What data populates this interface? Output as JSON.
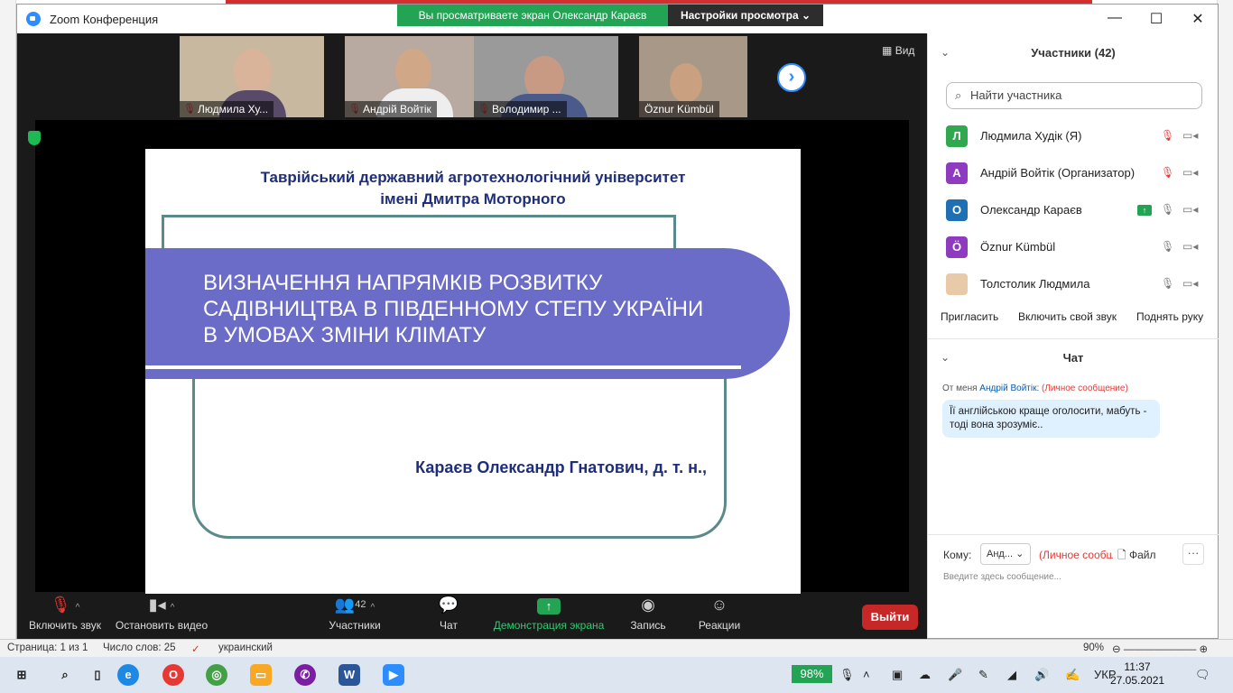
{
  "window": {
    "title": "Zoom Конференция"
  },
  "share_banner": {
    "text": "Вы просматриваете экран Олександр Караєв",
    "settings": "Настройки просмотра"
  },
  "view_button": "Вид",
  "thumbnails": [
    {
      "name": "Людмила Ху..."
    },
    {
      "name": "Андрій Войтік"
    },
    {
      "name": "Володимир ..."
    },
    {
      "name": "Öznur Kümbül"
    }
  ],
  "slide": {
    "university_line1": "Таврійський державний агротехнологічний університет",
    "university_line2": "імені Дмитра Моторного",
    "title_line1": "ВИЗНАЧЕННЯ НАПРЯМКІВ РОЗВИТКУ",
    "title_line2": "САДІВНИЦТВА В ПІВДЕННОМУ СТЕПУ УКРАЇНИ",
    "title_line3": "В УМОВАХ ЗМІНИ КЛІМАТУ",
    "author": "Караєв Олександр Гнатович, д. т. н.,"
  },
  "toolbar": {
    "unmute": "Включить звук",
    "stop_video": "Остановить видео",
    "participants": "Участники",
    "participants_count": "42",
    "chat": "Чат",
    "share": "Демонстрация экрана",
    "record": "Запись",
    "reactions": "Реакции",
    "leave": "Выйти"
  },
  "participants_panel": {
    "title": "Участники (42)",
    "search_placeholder": "Найти участника",
    "list": [
      {
        "initial": "Л",
        "name": "Людмила Худік (Я)",
        "color": "#2fa84f",
        "muted": true
      },
      {
        "initial": "А",
        "name": "Андрій Войтік (Организатор)",
        "color": "#8e3bbf",
        "muted": true
      },
      {
        "initial": "О",
        "name": "Олександр Караєв",
        "color": "#1f6fb5",
        "muted": false,
        "sharing": true
      },
      {
        "initial": "Ö",
        "name": "Öznur Kümbül",
        "color": "#8e3bbf",
        "muted": false
      },
      {
        "initial": "",
        "name": "Толстолик Людмила",
        "color": "#e8c9a8",
        "muted": false
      }
    ],
    "invite": "Пригласить",
    "unmute_me": "Включить свой звук",
    "raise_hand": "Поднять руку"
  },
  "chat_panel": {
    "title": "Чат",
    "from_prefix": "От меня",
    "from_name": "Андрій Войтік:",
    "private": "(Личное сообщение)",
    "message": "Її англійською краще оголосити, мабуть - тоді вона зрозуміє..",
    "to_label": "Кому:",
    "to_value": "Анд...",
    "private_short": "(Личное сообщ",
    "file": "Файл",
    "input_placeholder": "Введите здесь сообщение..."
  },
  "word_status": {
    "page": "Страница: 1 из 1",
    "words": "Число слов: 25",
    "language": "украинский",
    "zoom": "90%"
  },
  "taskbar": {
    "battery": "98%",
    "lang": "УКР",
    "time": "11:37",
    "date": "27.05.2021"
  }
}
